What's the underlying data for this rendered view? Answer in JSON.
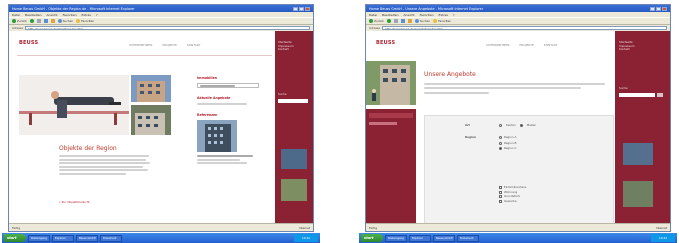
{
  "screens": [
    {
      "window_title": "Home Beuss GmbH - Objekte der Region.de - Microsoft Internet Explorer",
      "menu": [
        "Datei",
        "Bearbeiten",
        "Ansicht",
        "Favoriten",
        "Extras",
        "?"
      ],
      "toolbar": [
        "Zurück",
        "Suchen",
        "Favoriten"
      ],
      "address_label": "Adresse",
      "address": "http://www.beuss.de/objekte/index.htm",
      "logo": "BEUSS",
      "nav": [
        "UNTERNEHMEN",
        "PROJEKTE",
        "KONTAKT"
      ],
      "headline": "Objekte der Region",
      "sidebar_heads": [
        "Immobilien",
        "Aktuelle Angebote",
        "Referenzen"
      ],
      "link": "» Zur Objektübersicht",
      "rail_items": [
        "Startseite",
        "Impressum",
        "Kontakt",
        "Suche"
      ],
      "status": "Fertig",
      "zone": "Internet"
    },
    {
      "window_title": "Home Beuss GmbH - Unsere Angebote - Microsoft Internet Explorer",
      "menu": [
        "Datei",
        "Bearbeiten",
        "Ansicht",
        "Favoriten",
        "Extras",
        "?"
      ],
      "toolbar": [
        "Zurück",
        "Suchen",
        "Favoriten"
      ],
      "address_label": "Adresse",
      "address": "http://www.beuss.de/angebote/index.htm",
      "logo": "BEUSS",
      "nav": [
        "UNTERNEHMEN",
        "PROJEKTE",
        "KONTAKT"
      ],
      "headline": "Unsere Angebote",
      "form_labels": [
        "Art",
        "Region"
      ],
      "radio_options": [
        "Kaufen",
        "Mieten"
      ],
      "region_options": [
        "Region A",
        "Region B",
        "Region C"
      ],
      "checkboxes": [
        "Einfamilienhaus",
        "Wohnung",
        "Grundstück",
        "Gewerbe"
      ],
      "rail_items": [
        "Startseite",
        "Impressum",
        "Kontakt",
        "Suche"
      ],
      "status": "Fertig",
      "zone": "Internet"
    }
  ],
  "taskbar": {
    "start": "start",
    "tasks": [
      "Posteingang",
      "Explorer",
      "Beuss GmbH",
      "Dokument"
    ],
    "clock": "10:42"
  },
  "colors": {
    "accent": "#8b2233",
    "brand": "#b2202f",
    "titlebar": "#245ac2"
  }
}
